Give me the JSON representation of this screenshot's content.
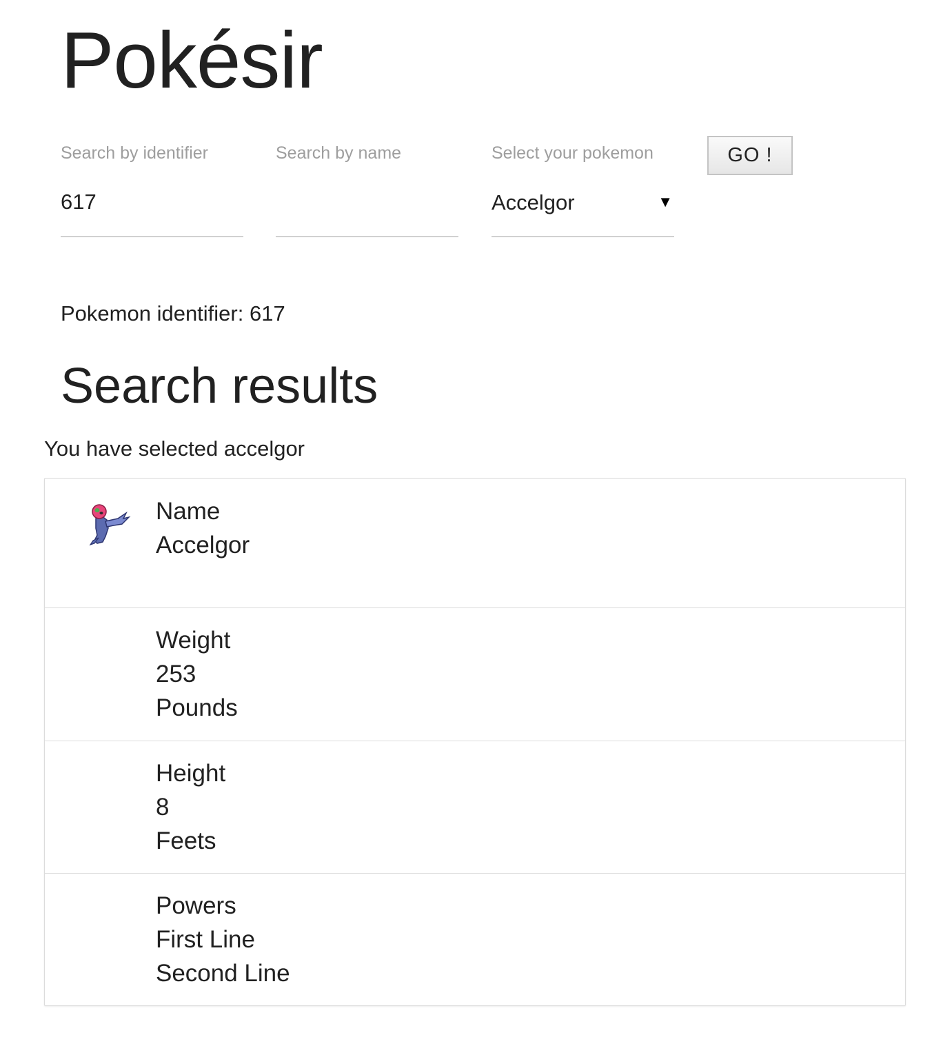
{
  "app": {
    "title": "Pokésir"
  },
  "search": {
    "identifier_label": "Search by identifier",
    "identifier_value": "617",
    "name_label": "Search by name",
    "name_value": "",
    "select_label": "Select your pokemon",
    "select_value": "Accelgor",
    "select_arrow_icon": "triangle-down-icon",
    "go_label": "GO !"
  },
  "status": {
    "pokemon_identifier": "Pokemon identifier: 617"
  },
  "results": {
    "heading": "Search results",
    "selected_text": "You have selected accelgor",
    "sprite_icon": "accelgor-sprite-icon",
    "name": {
      "title": "Name",
      "value": "Accelgor"
    },
    "weight": {
      "title": "Weight",
      "value": "253",
      "unit": "Pounds"
    },
    "height": {
      "title": "Height",
      "value": "8",
      "unit": "Feets"
    },
    "powers": {
      "title": "Powers",
      "line1": "First Line",
      "line2": "Second Line"
    }
  }
}
